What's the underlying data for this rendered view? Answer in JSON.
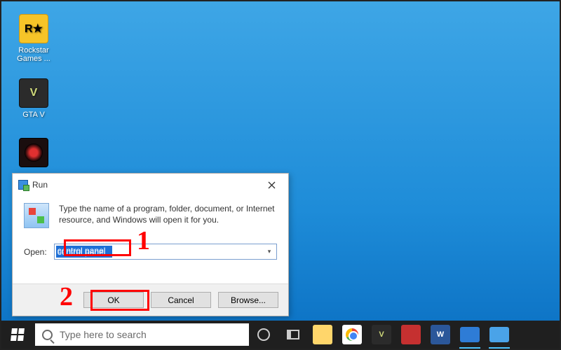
{
  "desktop": {
    "icons": [
      {
        "label": "Rockstar Games ...",
        "tile_text": "R★"
      },
      {
        "label": "GTA V",
        "tile_text": "V"
      },
      {
        "label": "",
        "tile_text": ""
      }
    ]
  },
  "run_dialog": {
    "title": "Run",
    "description": "Type the name of a program, folder, document, or Internet resource, and Windows will open it for you.",
    "open_label": "Open:",
    "open_value": "control panel",
    "buttons": {
      "ok": "OK",
      "cancel": "Cancel",
      "browse": "Browse..."
    }
  },
  "annotations": {
    "one": "1",
    "two": "2"
  },
  "taskbar": {
    "search_placeholder": "Type here to search"
  }
}
